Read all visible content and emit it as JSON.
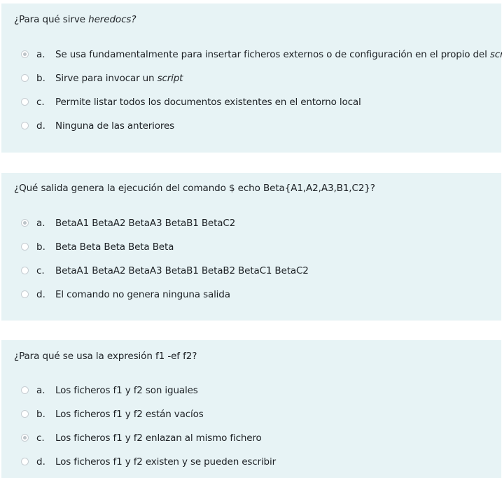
{
  "questions": [
    {
      "text": "¿Para qué sirve ",
      "text_em": "heredocs?",
      "options": [
        {
          "letter": "a.",
          "label": "Se usa fundamentalmente para insertar ficheros externos o de configuración en el propio del ",
          "label_em": "script",
          "checked": true
        },
        {
          "letter": "b.",
          "label": "Sirve para invocar un ",
          "label_em": "script",
          "checked": false
        },
        {
          "letter": "c.",
          "label": "Permite listar todos los documentos existentes en el entorno local",
          "label_em": "",
          "checked": false
        },
        {
          "letter": "d.",
          "label": "Ninguna de las anteriores",
          "label_em": "",
          "checked": false
        }
      ]
    },
    {
      "text": "¿Qué salida genera la ejecución del comando $ echo Beta{A1,A2,A3,B1,C2}?",
      "text_em": "",
      "options": [
        {
          "letter": "a.",
          "label": "BetaA1 BetaA2 BetaA3 BetaB1 BetaC2",
          "label_em": "",
          "checked": true
        },
        {
          "letter": "b.",
          "label": "Beta Beta Beta Beta Beta",
          "label_em": "",
          "checked": false
        },
        {
          "letter": "c.",
          "label": "BetaA1 BetaA2 BetaA3 BetaB1 BetaB2 BetaC1 BetaC2",
          "label_em": "",
          "checked": false
        },
        {
          "letter": "d.",
          "label": "El comando no genera ninguna salida",
          "label_em": "",
          "checked": false
        }
      ]
    },
    {
      "text": "¿Para qué se usa la expresión f1 -ef f2?",
      "text_em": "",
      "options": [
        {
          "letter": "a.",
          "label": "Los ficheros f1 y f2 son iguales",
          "label_em": "",
          "checked": false
        },
        {
          "letter": "b.",
          "label": "Los ficheros f1 y f2 están vacíos",
          "label_em": "",
          "checked": false
        },
        {
          "letter": "c.",
          "label": "Los ficheros f1 y f2 enlazan al mismo fichero",
          "label_em": "",
          "checked": true
        },
        {
          "letter": "d.",
          "label": "Los ficheros f1 y f2 existen y se pueden escribir",
          "label_em": "",
          "checked": false
        }
      ]
    }
  ],
  "colors": {
    "card_background": "#e7f3f5",
    "text": "#1d2125",
    "radio_border": "#c6cdd2",
    "radio_dot": "#bcc3c8"
  }
}
